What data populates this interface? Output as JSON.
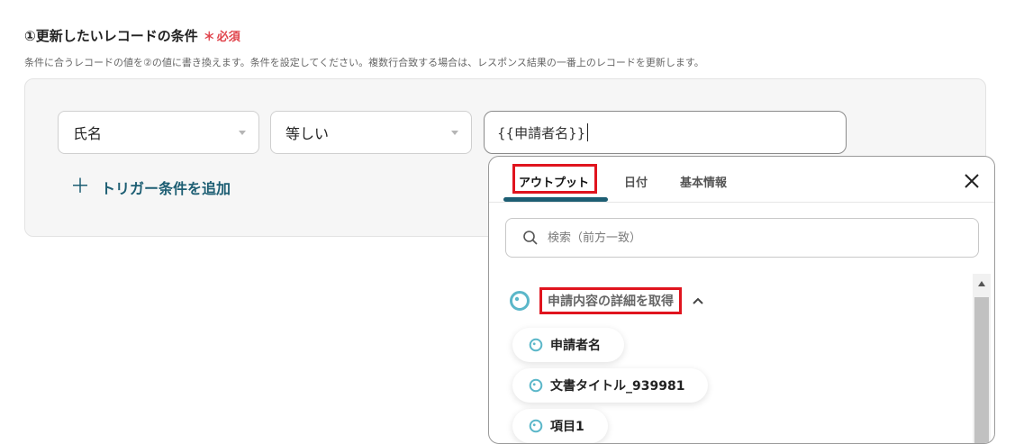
{
  "section": {
    "title": "①更新したいレコードの条件",
    "required_mark": "＊",
    "required_label": "必須",
    "description": "条件に合うレコードの値を②の値に書き換えます。条件を設定してください。複数行合致する場合は、レスポンス結果の一番上のレコードを更新します。"
  },
  "condition": {
    "field": "氏名",
    "operator": "等しい",
    "value": "{{申請者名}}"
  },
  "add_trigger_label": "トリガー条件を追加",
  "dropdown": {
    "tabs": [
      {
        "label": "アウトプット",
        "active": true
      },
      {
        "label": "日付",
        "active": false
      },
      {
        "label": "基本情報",
        "active": false
      }
    ],
    "search_placeholder": "検索（前方一致）",
    "group_label": "申請内容の詳細を取得",
    "items": [
      {
        "label": "申請者名"
      },
      {
        "label": "文書タイトル_939981"
      },
      {
        "label": "項目1"
      }
    ]
  },
  "colors": {
    "accent": "#1d5e73",
    "highlight": "#e0141e",
    "required": "#e0434b",
    "icon": "#5bb7c9"
  }
}
